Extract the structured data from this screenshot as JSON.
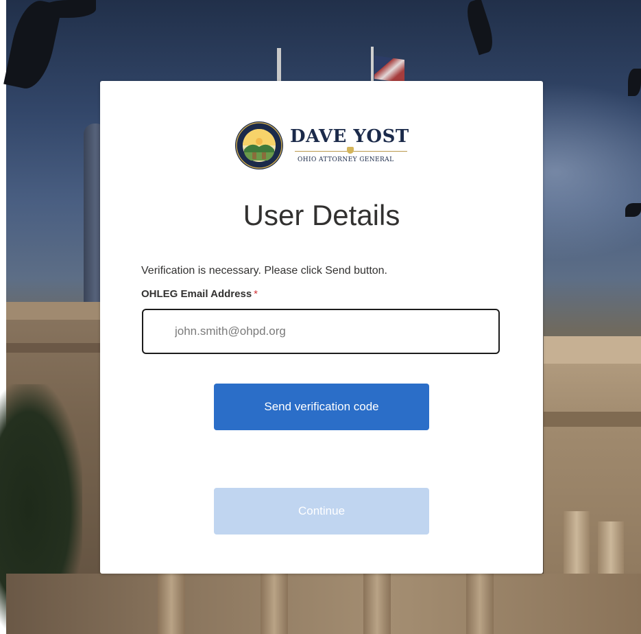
{
  "brand": {
    "name": "DAVE YOST",
    "subtitle": "OHIO ATTORNEY GENERAL",
    "seal_ring_text": "THE ATTORNEY GENERAL OF THE STATE OF OHIO"
  },
  "page": {
    "title": "User Details",
    "intro": "Verification is necessary. Please click Send button."
  },
  "email_field": {
    "label": "OHLEG Email Address",
    "required_marker": "*",
    "value": "",
    "placeholder": "john.smith@ohpd.org"
  },
  "buttons": {
    "send_label": "Send verification code",
    "continue_label": "Continue"
  },
  "colors": {
    "primary": "#2b6ec8",
    "primary_disabled": "#c0d5f0",
    "brand_navy": "#1b2a4a",
    "brand_gold": "#b8974a",
    "required": "#d13438"
  }
}
